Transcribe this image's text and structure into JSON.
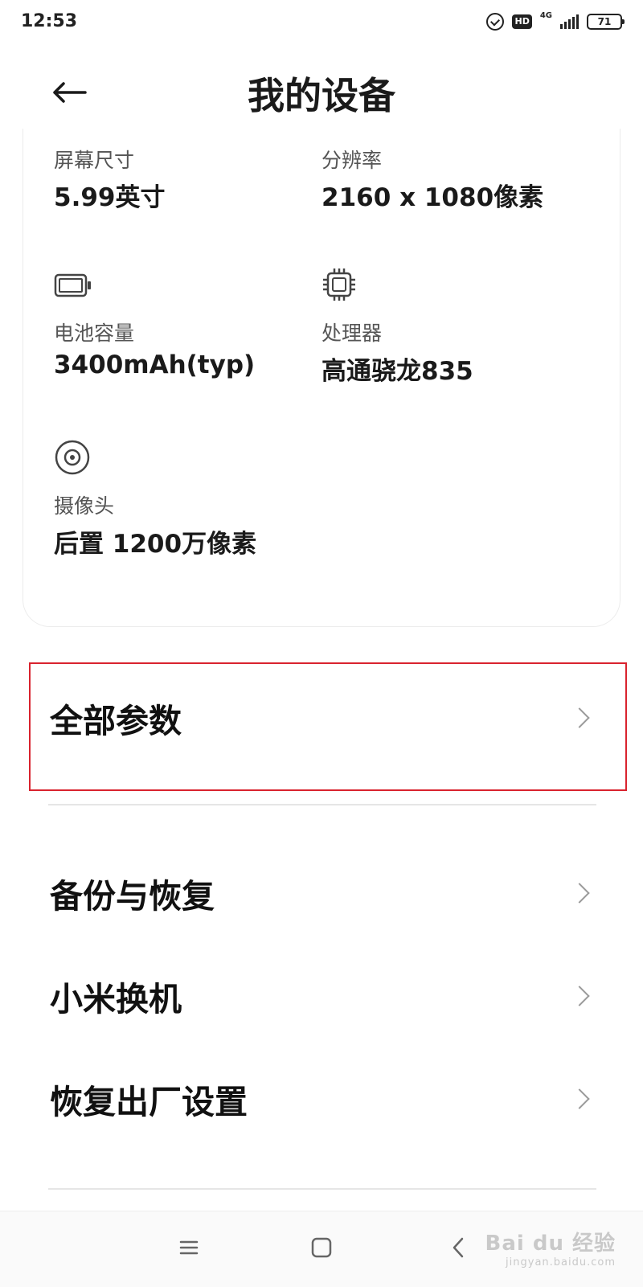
{
  "status_bar": {
    "time": "12:53",
    "hd_label": "HD",
    "network_label": "4G",
    "battery_level": "71"
  },
  "header": {
    "title": "我的设备",
    "back_icon": "arrow-left-icon"
  },
  "specs": [
    {
      "label": "屏幕尺寸",
      "value": "5.99英寸"
    },
    {
      "label": "分辨率",
      "value": "2160 x 1080像素"
    },
    {
      "label": "电池容量",
      "value": "3400mAh(typ)",
      "icon": "battery-icon"
    },
    {
      "label": "处理器",
      "value": "高通骁龙835",
      "icon": "chip-icon"
    },
    {
      "label": "摄像头",
      "value": "后置 1200万像素",
      "icon": "camera-lens-icon"
    }
  ],
  "menu": {
    "all_params": "全部参数",
    "items": [
      "备份与恢复",
      "小米换机",
      "恢复出厂设置"
    ]
  },
  "nav": {
    "menu_icon": "hamburger-icon",
    "home_icon": "square-icon",
    "back_icon": "chevron-left-icon"
  },
  "watermark": {
    "main": "Bai du 经验",
    "sub": "jingyan.baidu.com"
  },
  "colors": {
    "highlight": "#d9232e",
    "text": "#1a1a1a",
    "label": "#555555"
  }
}
